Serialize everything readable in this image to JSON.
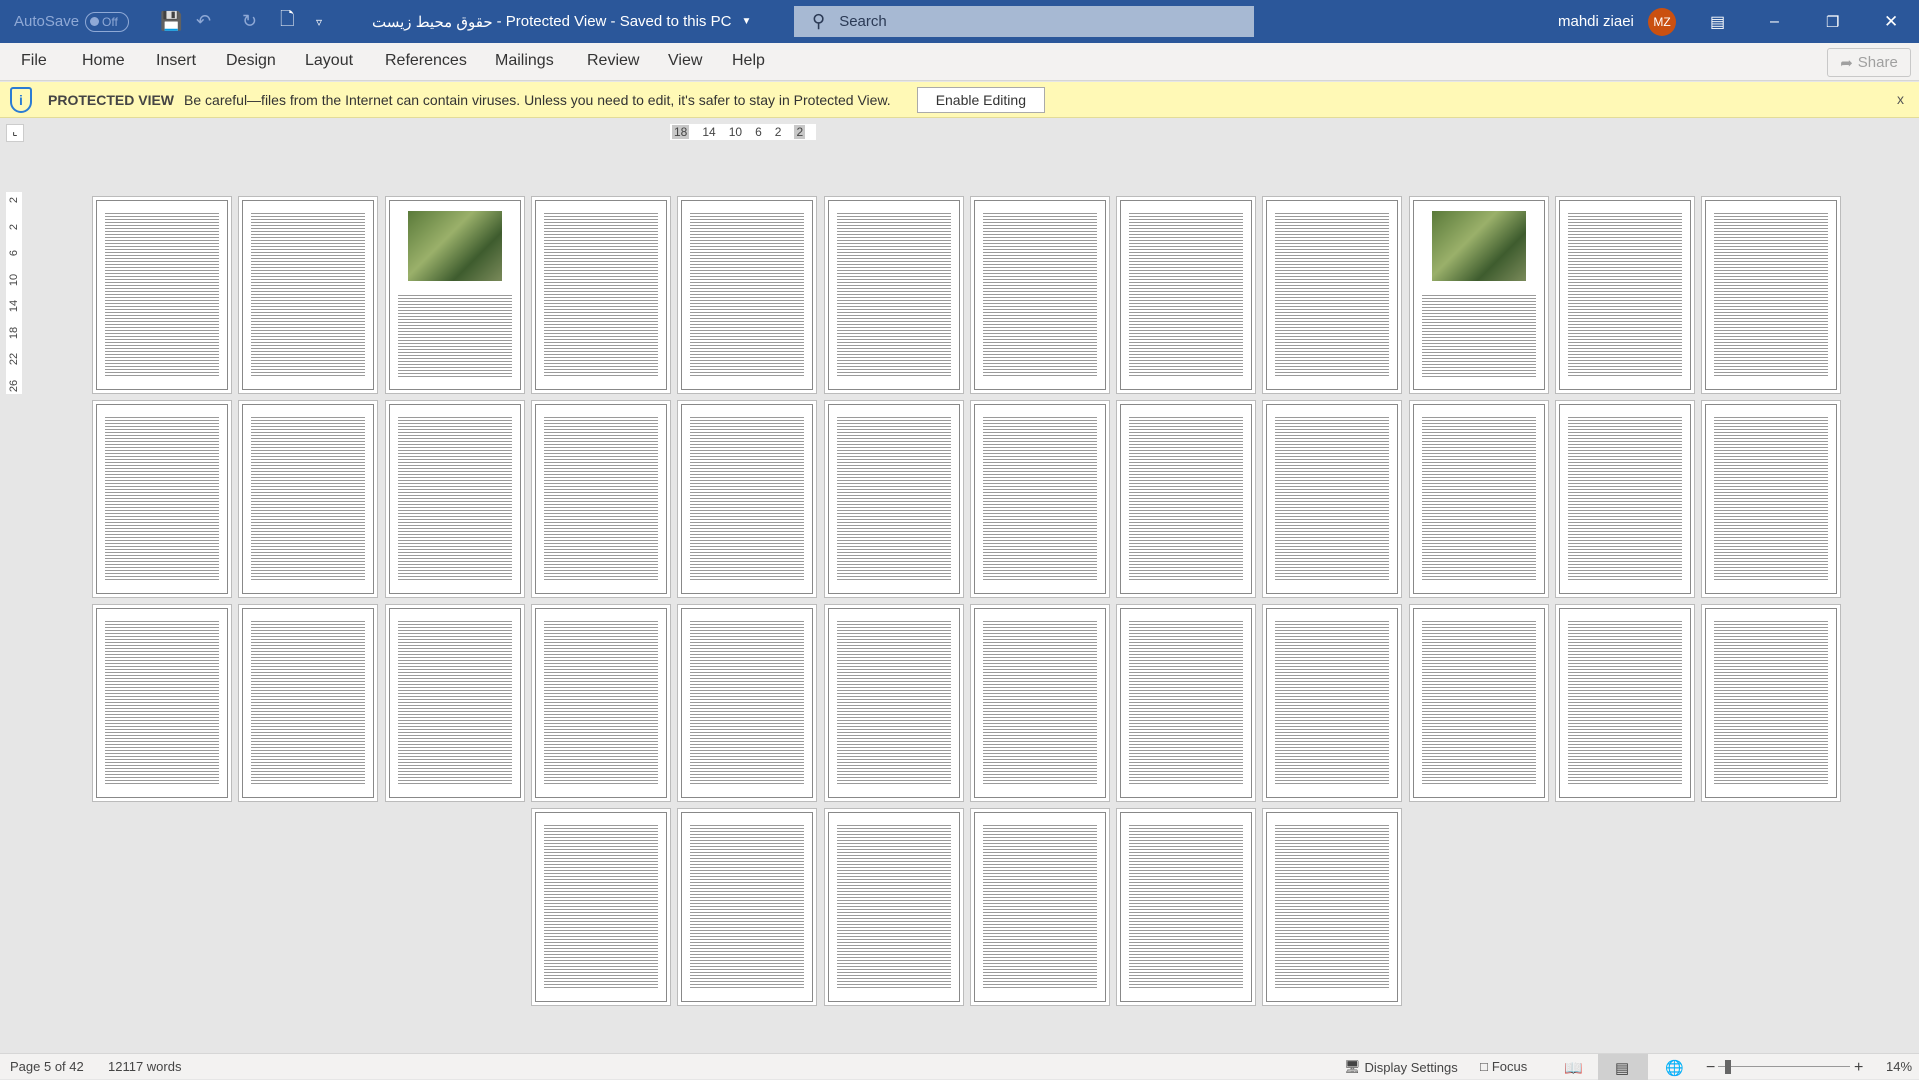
{
  "titlebar": {
    "autosave_label": "AutoSave",
    "autosave_state": "Off",
    "doc_title": "حقوق محیط زیست",
    "title_suffix": " - Protected View - Saved to this PC",
    "search_placeholder": "Search",
    "user_name": "mahdi ziaei",
    "user_initials": "MZ",
    "avatar_color": "#ca5010",
    "accent": "#2b579a"
  },
  "ribbon": {
    "tabs": [
      "File",
      "Home",
      "Insert",
      "Design",
      "Layout",
      "References",
      "Mailings",
      "Review",
      "View",
      "Help"
    ],
    "share_label": "Share"
  },
  "protected_view": {
    "title": "PROTECTED VIEW",
    "message": "Be careful—files from the Internet can contain viruses. Unless you need to edit, it's safer to stay in Protected View.",
    "enable_label": "Enable Editing",
    "close_label": "x"
  },
  "ruler": {
    "horizontal": [
      "18",
      "14",
      "10",
      "6",
      "2",
      "2"
    ],
    "vertical": [
      "2",
      "2",
      "6",
      "10",
      "14",
      "18",
      "22",
      "26"
    ]
  },
  "document": {
    "page_count": 42,
    "pages_with_images": [
      3,
      10
    ]
  },
  "status": {
    "page": "Page 5 of 42",
    "words": "12117 words",
    "display_settings": "Display Settings",
    "focus": "Focus",
    "zoom": "14%",
    "zoom_percent": 14
  }
}
